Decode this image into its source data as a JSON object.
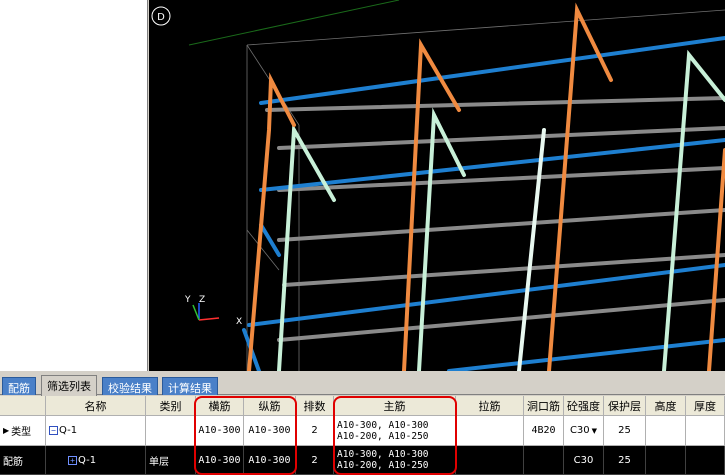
{
  "viewport": {
    "view_label": "D",
    "axis_y": "Y",
    "axis_z": "Z",
    "axis_x": "X"
  },
  "tabs": [
    {
      "label": "配筋",
      "active": false
    },
    {
      "label": "筛选列表",
      "active": true
    },
    {
      "label": "校验结果",
      "active": false
    },
    {
      "label": "计算结果",
      "active": false
    }
  ],
  "grid": {
    "headers": {
      "name": "名称",
      "category": "类别",
      "horizontal_bar": "横筋",
      "vertical_bar": "纵筋",
      "rows_count": "排数",
      "main_bar": "主筋",
      "tie_bar": "拉筋",
      "opening_bar": "洞口筋",
      "concrete_grade": "砼强度",
      "cover": "保护层",
      "height": "高度",
      "thickness": "厚度"
    },
    "row1": {
      "label": "类型",
      "name": "Q-1",
      "category": "",
      "horizontal_bar": "A10-300",
      "vertical_bar": "A10-300",
      "rows_count": "2",
      "main_bar_line1": "A10-300, A10-300",
      "main_bar_line2": "A10-200, A10-250",
      "tie_bar": "",
      "opening_bar": "4B20",
      "concrete_grade": "C30",
      "cover": "25",
      "height": "",
      "thickness": ""
    },
    "row2": {
      "label": "配筋",
      "name": "Q-1",
      "category": "单层",
      "horizontal_bar": "A10-300",
      "vertical_bar": "A10-300",
      "rows_count": "2",
      "main_bar_line1": "A10-300, A10-300",
      "main_bar_line2": "A10-200, A10-250",
      "tie_bar": "",
      "opening_bar": "",
      "concrete_grade": "C30",
      "cover": "25",
      "height": "",
      "thickness": ""
    }
  },
  "colors": {
    "blue_bar": "#1e7fd0",
    "orange_bar": "#f08a40",
    "green_bar": "#c8f0d8",
    "gray_bar": "#8a8a8a",
    "highlight": "#e00000"
  }
}
